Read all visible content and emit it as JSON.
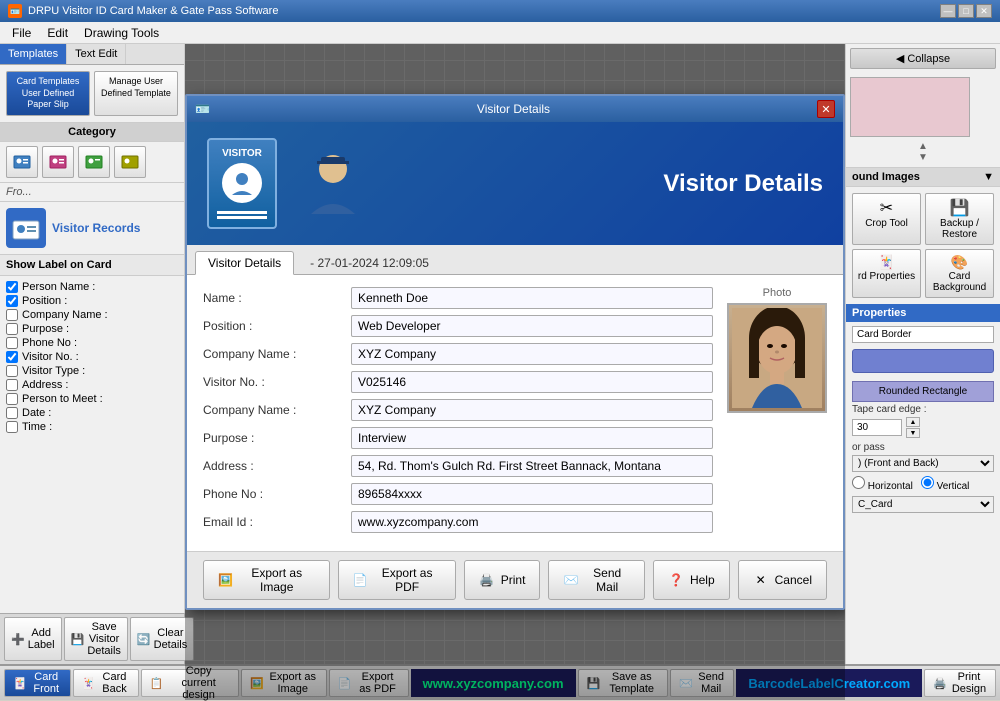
{
  "app": {
    "title": "DRPU Visitor ID Card Maker & Gate Pass Software",
    "icon": "🪪"
  },
  "titlebar": {
    "minimize": "—",
    "maximize": "□",
    "close": "✕"
  },
  "menu": {
    "items": [
      "File",
      "Edit",
      "Drawing Tools"
    ]
  },
  "left_panel": {
    "tabs": [
      "Templates",
      "Text Edit"
    ],
    "template_buttons": [
      {
        "id": "card-templates",
        "label": "Card Templates\nUser Defined\nPaper Slip"
      },
      {
        "id": "manage-template",
        "label": "Manage User Defined Template"
      }
    ],
    "category_label": "Category",
    "visitor_records": "Visitor Records",
    "show_label": "Show Label on Card",
    "checkboxes": [
      {
        "label": "Person Name :",
        "checked": true
      },
      {
        "label": "Position :",
        "checked": true
      },
      {
        "label": "Company Name :",
        "checked": false
      },
      {
        "label": "Purpose :",
        "checked": false
      },
      {
        "label": "Phone No :",
        "checked": false
      },
      {
        "label": "Visitor No. :",
        "checked": true
      },
      {
        "label": "Visitor Type :",
        "checked": false
      },
      {
        "label": "Address :",
        "checked": false
      },
      {
        "label": "Person to Meet :",
        "checked": false
      },
      {
        "label": "Date :",
        "checked": false
      },
      {
        "label": "Time :",
        "checked": false
      }
    ]
  },
  "right_panel": {
    "collapse_label": "Collapse",
    "bg_images_label": "ound Images",
    "crop_tool_label": "Crop Tool",
    "backup_restore_label": "Backup / Restore",
    "card_properties_label": "rd Properties",
    "card_background_label": "Card Background",
    "properties_label": "Properties",
    "card_border_label": "Card Border",
    "rounded_rect_label": "Rounded Rectangle",
    "shape_card_edge": "Tape card edge :",
    "shape_value": "30",
    "or_pass_label": "or pass",
    "front_back_label": ") (Front and Back)",
    "horizontal_label": "Horizontal",
    "vertical_label": "Vertical",
    "c_card_label": "C_Card"
  },
  "modal": {
    "title": "Visitor Details",
    "icon": "🪪",
    "close": "✕",
    "header_title": "Visitor Details",
    "badge_text": "VISITOR",
    "tab": "Visitor Details",
    "datetime": "27-01-2024 12:09:05",
    "photo_label": "Photo",
    "fields": [
      {
        "label": "Name :",
        "value": "Kenneth Doe"
      },
      {
        "label": "Position :",
        "value": "Web Developer"
      },
      {
        "label": "Company Name :",
        "value": "XYZ Company"
      },
      {
        "label": "Visitor No. :",
        "value": "V025146"
      },
      {
        "label": "Company Name :",
        "value": "XYZ Company"
      },
      {
        "label": "Purpose :",
        "value": "Interview"
      },
      {
        "label": "Address :",
        "value": "54, Rd. Thom's Gulch Rd. First Street Bannack, Montana"
      },
      {
        "label": "Phone No :",
        "value": "896584xxxx"
      },
      {
        "label": "Email Id :",
        "value": "www.xyzcompany.com"
      }
    ],
    "footer_buttons": [
      {
        "id": "export-image",
        "label": "Export as Image",
        "icon": "🖼️"
      },
      {
        "id": "export-pdf",
        "label": "Export as PDF",
        "icon": "📄"
      },
      {
        "id": "print",
        "label": "Print",
        "icon": "🖨️"
      },
      {
        "id": "send-mail",
        "label": "Send Mail",
        "icon": "✉️"
      },
      {
        "id": "help",
        "label": "Help",
        "icon": "❓"
      },
      {
        "id": "cancel",
        "label": "Cancel",
        "icon": "✕"
      }
    ]
  },
  "add_label_bar": {
    "add_label": "Add Label",
    "save_visitor": "Save Visitor Details",
    "clear_details": "Clear Details"
  },
  "bottom_bar": {
    "card_front": "Card Front",
    "card_back": "Card Back",
    "copy_design": "Copy current design",
    "export_image": "Export as Image",
    "export_pdf": "Export as PDF",
    "save_template": "Save as Template",
    "send_mail": "Send Mail",
    "print_design": "Print Design",
    "banner1": "www.xyzcompany.com",
    "banner2": "BarcodeLabelCreator.com"
  }
}
